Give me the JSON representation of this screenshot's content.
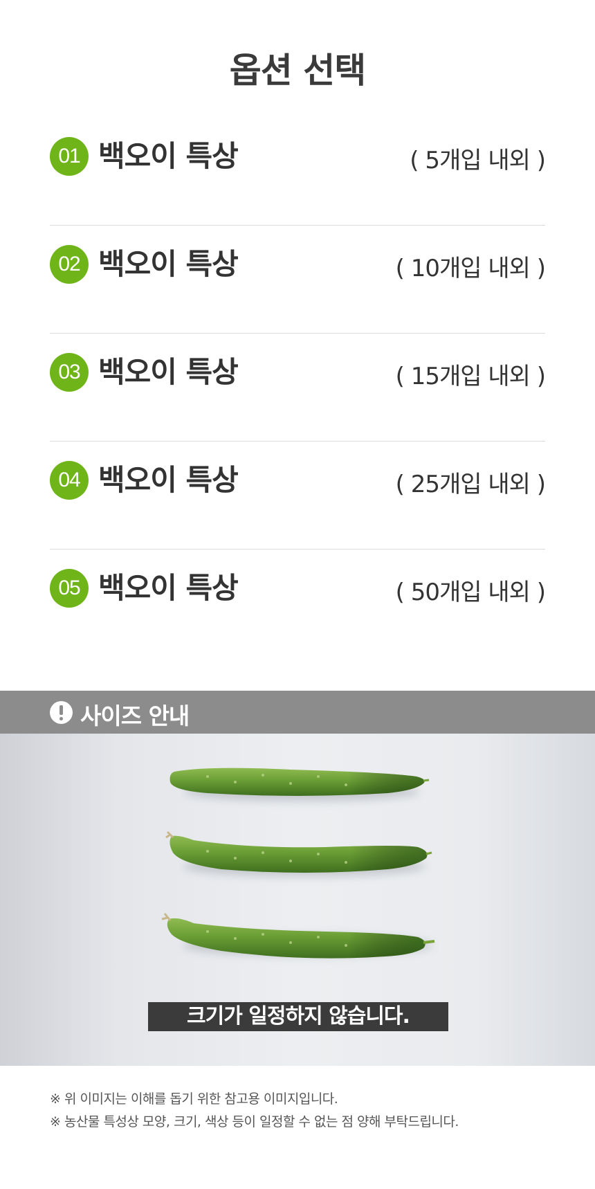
{
  "title": "옵션 선택",
  "options": [
    {
      "num": "01",
      "name": "백오이 특상",
      "qty": "( 5개입 내외 )"
    },
    {
      "num": "02",
      "name": "백오이 특상",
      "qty": "( 10개입 내외 )"
    },
    {
      "num": "03",
      "name": "백오이 특상",
      "qty": "( 15개입 내외 )"
    },
    {
      "num": "04",
      "name": "백오이 특상",
      "qty": "( 25개입 내외 )"
    },
    {
      "num": "05",
      "name": "백오이 특상",
      "qty": "( 50개입 내외 )"
    }
  ],
  "size_guide": {
    "label": "사이즈 안내",
    "icon": "exclamation-circle-icon",
    "photo": "cucumbers-photo",
    "caption": "크기가 일정하지 않습니다."
  },
  "notes": [
    "※ 위 이미지는 이해를 돕기 위한 참고용 이미지입니다.",
    "※ 농산물 특성상 모양, 크기, 색상 등이 일정할 수 없는 점 양해 부탁드립니다."
  ],
  "colors": {
    "accent": "#6fb51a",
    "header_bar": "#8c8c8c",
    "caption_bg": "#3b3b3b",
    "text": "#333333"
  }
}
